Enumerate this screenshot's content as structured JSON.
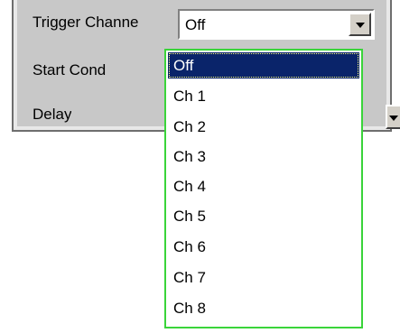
{
  "panel": {
    "labels": {
      "trigger_channel": "Trigger Channe",
      "start_cond": "Start Cond",
      "delay": "Delay"
    },
    "trigger_channel_value": "Off"
  },
  "dropdown": {
    "options": [
      "Off",
      "Ch 1",
      "Ch 2",
      "Ch 3",
      "Ch 4",
      "Ch 5",
      "Ch 6",
      "Ch 7",
      "Ch 8"
    ],
    "selected": "Off"
  },
  "icons": {
    "combo_arrow": "chevron-down-icon",
    "side_arrow": "chevron-down-icon"
  },
  "colors": {
    "panel_bg": "#c8c8c8",
    "selection_bg": "#0a246a",
    "dropdown_border": "#3ad43a"
  }
}
